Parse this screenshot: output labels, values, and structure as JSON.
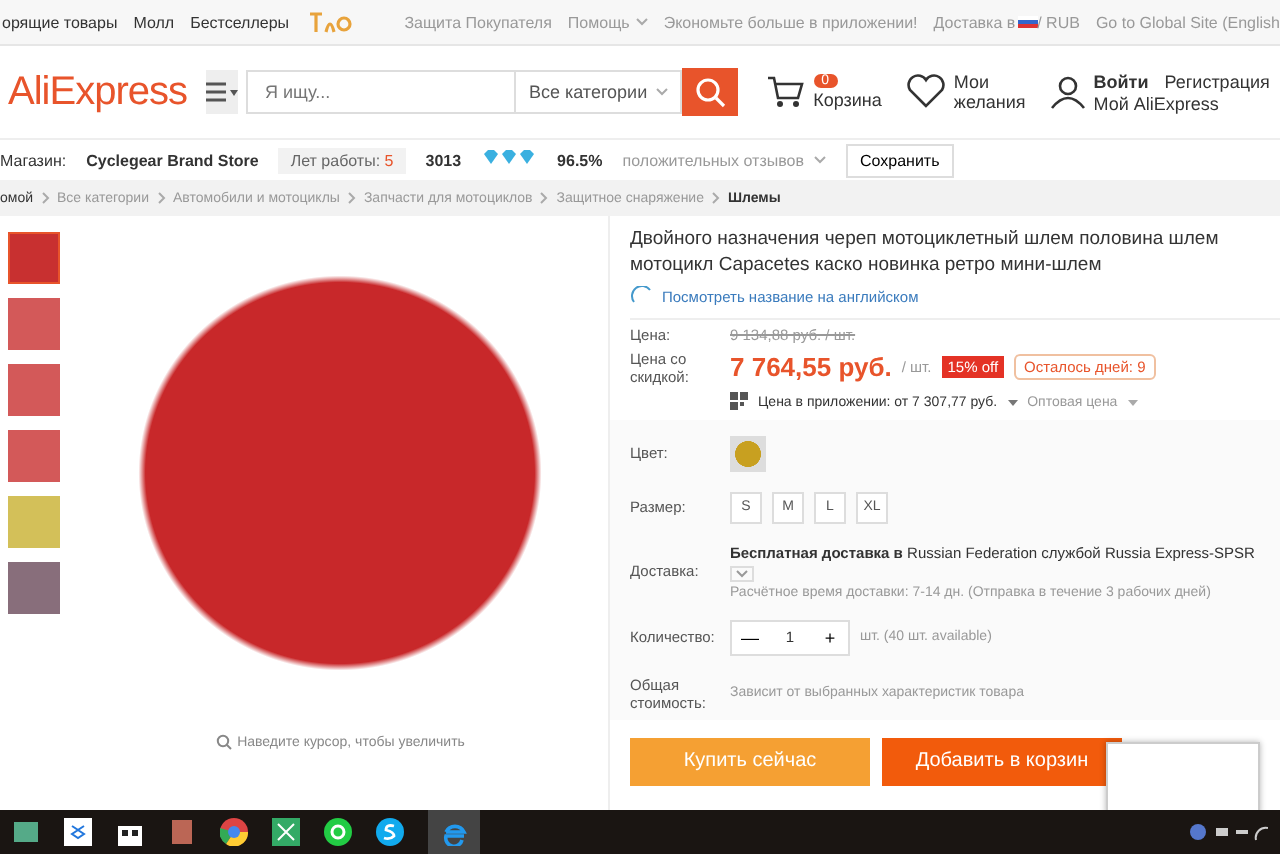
{
  "top_bar": {
    "left_links": [
      "орящие товары",
      "Молл",
      "Бестселлеры"
    ],
    "right_links": [
      {
        "label": "Защита Покупателя",
        "kind": "plain"
      },
      {
        "label": "Помощь",
        "kind": "dropdown"
      },
      {
        "label": "Экономьте больше в приложении!",
        "kind": "phone"
      },
      {
        "label": "Доставка в",
        "kind": "flag",
        "extra": "/ RUB"
      },
      {
        "label": "Go to Global Site (English",
        "kind": "plain"
      }
    ]
  },
  "header": {
    "logo": "AliExpress",
    "search": {
      "placeholder": "Я ищу...",
      "category": "Все категории"
    },
    "cart": {
      "count": "0",
      "label": "Корзина"
    },
    "wishlist": "Мои желания",
    "account": {
      "login": "Войти",
      "register": "Регистрация",
      "my": "Мой AliExpress"
    }
  },
  "store_bar": {
    "label": "Магазин:",
    "name": "Cyclegear Brand Store",
    "years_label": "Лет работы:",
    "years": "5",
    "score": "3013",
    "feedback_percent": "96.5%",
    "feedback_label": "положительных отзывов",
    "save": "Сохранить"
  },
  "breadcrumb": [
    "омой",
    "Все категории",
    "Автомобили и мотоциклы",
    "Запчасти для мотоциклов",
    "Защитное снаряжение",
    "Шлемы"
  ],
  "gallery": {
    "thumbnails": [
      {
        "selected": true
      },
      {
        "selected": false
      },
      {
        "selected": false
      },
      {
        "selected": false
      },
      {
        "selected": false
      },
      {
        "selected": false
      }
    ],
    "zoom_hint": "Наведите курсор, чтобы увеличить"
  },
  "product": {
    "title": "Двойного назначения череп мотоциклетный шлем половина шлем мотоцикл Capacetes каско новинка ретро мини-шлем",
    "translate_link": "Посмотреть название на английском",
    "price_label": "Цена:",
    "old_price": "9 134,88 руб. / шт.",
    "sale_label": "Цена со скидкой:",
    "price": "7 764,55 руб.",
    "unit": "/ шт.",
    "discount": "15% off",
    "days_left": "Осталось дней: 9",
    "app_price": "Цена в приложении: от 7 307,77 руб.",
    "wholesale": "Оптовая цена",
    "color_label": "Цвет:",
    "size_label": "Размер:",
    "sizes": [
      {
        "label": "S",
        "selected": false
      },
      {
        "label": "M",
        "selected": false
      },
      {
        "label": "L",
        "selected": false
      },
      {
        "label": "XL",
        "selected": false
      }
    ],
    "delivery_label": "Доставка:",
    "delivery": "**Бесплатная доставка в** Russian Federation службой Russia Express-SPSR",
    "delivery_time": "Расчётное время доставки: 7-14 дн. (Отправка в течение 3 рабочих дней)",
    "qty_label": "Количество:",
    "qty_minus": "—",
    "qty": "1",
    "qty_plus": "+",
    "qty_available": "шт. (40 шт. available)",
    "total_label": "Общая стоимость:",
    "total": "Зависит от выбранных характеристик товара",
    "buy": "Купить сейчас",
    "add_cart": "Добавить в корзин"
  }
}
